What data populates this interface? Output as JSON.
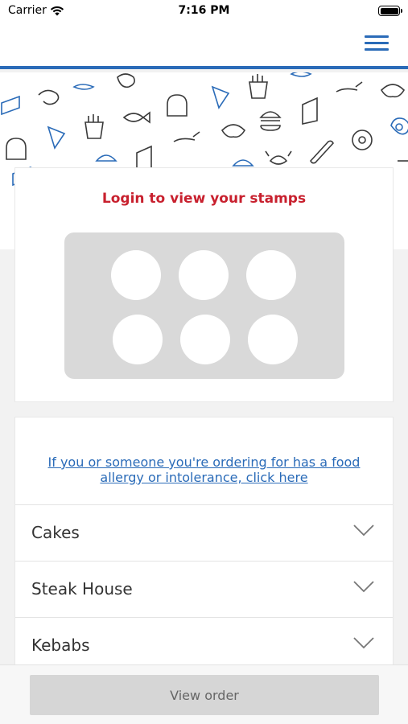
{
  "status_bar": {
    "carrier": "Carrier",
    "time": "7:16 PM"
  },
  "nav": {
    "menu_icon": "hamburger-menu-icon",
    "accent_color": "#2a6bb8"
  },
  "stamps": {
    "title": "Login to view your stamps",
    "title_color": "#c8202e",
    "count": 6
  },
  "allergy": {
    "link_text": "If you or someone you're ordering for has a food allergy or intolerance, click here"
  },
  "categories": [
    {
      "label": "Cakes"
    },
    {
      "label": "Steak House"
    },
    {
      "label": "Kebabs"
    }
  ],
  "footer": {
    "view_order_label": "View order"
  }
}
